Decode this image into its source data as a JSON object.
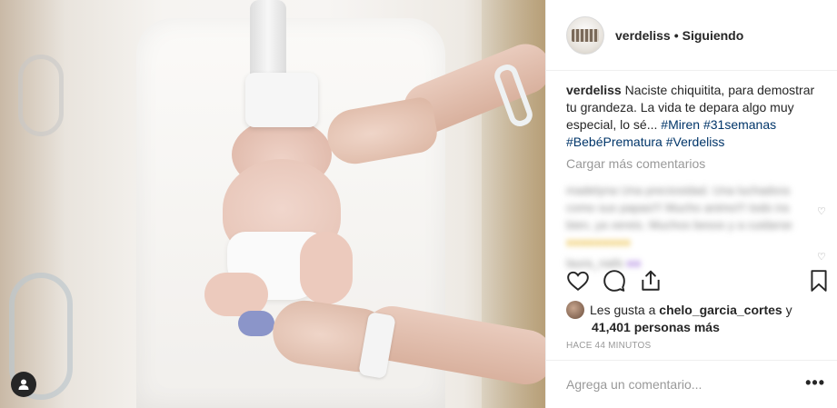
{
  "post": {
    "username": "verdeliss",
    "separator": "•",
    "follow_status": "Siguiendo",
    "caption_user": "verdeliss",
    "caption_text": " Naciste chiquitita, para demostrar tu grandeza. La vida te depara algo muy especial, lo sé... ",
    "hashtags": [
      "#Miren",
      "#31semanas",
      "#BebéPrematura",
      "#Verdeliss"
    ],
    "load_more": "Cargar más comentarios",
    "likes_prefix": "Les gusta a ",
    "likes_user": "chelo_garcia_cortes",
    "likes_mid": " y",
    "likes_count": "41,401 personas más",
    "time_ago": "HACE 44 MINUTOS",
    "add_comment_placeholder": "Agrega un comentario...",
    "more_options": "•••"
  },
  "blurred_comments": [
    "madelyna Una preciosidad. Una luchadora como sus papas!!! Mucho animo!!! todo ira bien, ya vereis. Muchos besos y a cuidarse",
    "laura_nails"
  ],
  "icons": {
    "heart": "heart-icon",
    "comment": "comment-icon",
    "share": "share-icon",
    "save": "bookmark-icon",
    "user_tag": "user-tag-icon"
  },
  "colors": {
    "text": "#262626",
    "hashtag": "#003569",
    "muted": "#999999",
    "border": "#efefef"
  }
}
